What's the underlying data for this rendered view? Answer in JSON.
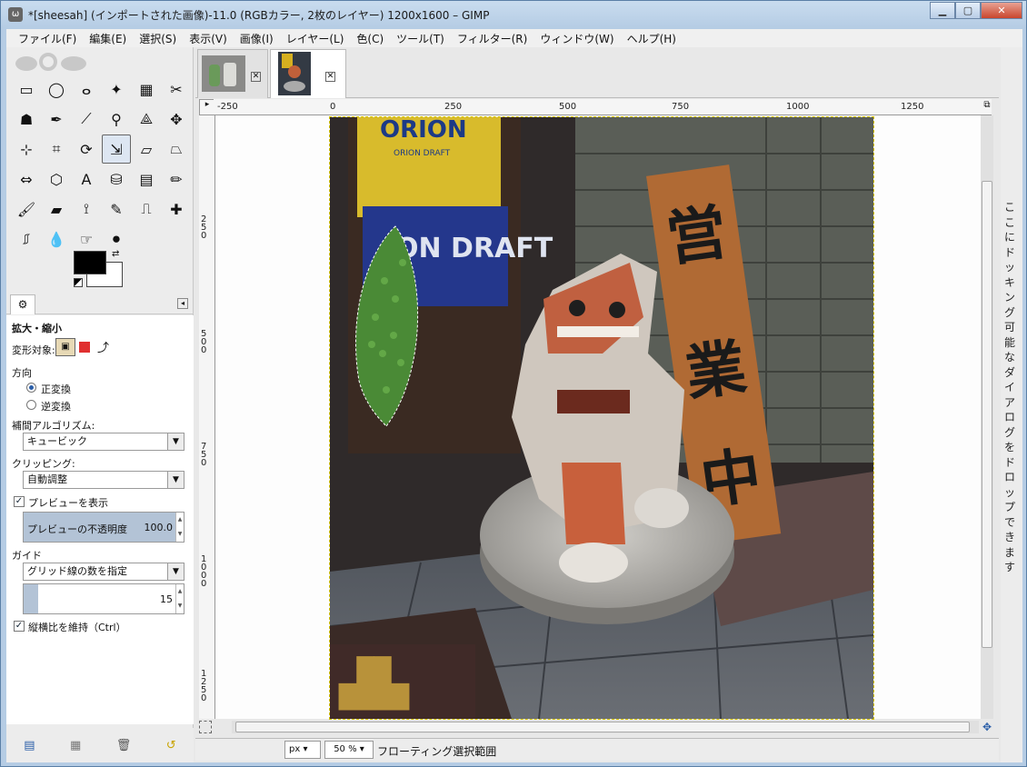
{
  "window": {
    "title": "*[sheesah] (インポートされた画像)-11.0 (RGBカラー, 2枚のレイヤー) 1200x1600 – GIMP",
    "icon": "gimp-icon",
    "controls": {
      "minimize": "▁",
      "maximize": "▢",
      "close": "✕"
    }
  },
  "menubar": [
    "ファイル(F)",
    "編集(E)",
    "選択(S)",
    "表示(V)",
    "画像(I)",
    "レイヤー(L)",
    "色(C)",
    "ツール(T)",
    "フィルター(R)",
    "ウィンドウ(W)",
    "ヘルプ(H)"
  ],
  "toolbox": {
    "tools": [
      {
        "name": "rect-select-icon",
        "glyph": "▭"
      },
      {
        "name": "ellipse-select-icon",
        "glyph": "◯"
      },
      {
        "name": "lasso-icon",
        "glyph": "ⴰ"
      },
      {
        "name": "fuzzy-select-icon",
        "glyph": "✦"
      },
      {
        "name": "color-select-icon",
        "glyph": "▦"
      },
      {
        "name": "scissors-icon",
        "glyph": "✂"
      },
      {
        "name": "foreground-select-icon",
        "glyph": "☗"
      },
      {
        "name": "paths-icon",
        "glyph": "✒"
      },
      {
        "name": "color-picker-icon",
        "glyph": "⟋"
      },
      {
        "name": "zoom-icon",
        "glyph": "⚲"
      },
      {
        "name": "measure-icon",
        "glyph": "⟁"
      },
      {
        "name": "move-icon",
        "glyph": "✥"
      },
      {
        "name": "align-icon",
        "glyph": "⊹"
      },
      {
        "name": "crop-icon",
        "glyph": "⌗"
      },
      {
        "name": "rotate-icon",
        "glyph": "⟳"
      },
      {
        "name": "scale-icon",
        "glyph": "⇲",
        "active": true
      },
      {
        "name": "shear-icon",
        "glyph": "▱"
      },
      {
        "name": "perspective-icon",
        "glyph": "⏢"
      },
      {
        "name": "flip-icon",
        "glyph": "⇔"
      },
      {
        "name": "cage-icon",
        "glyph": "⬡"
      },
      {
        "name": "text-icon",
        "glyph": "A"
      },
      {
        "name": "bucket-fill-icon",
        "glyph": "⛁"
      },
      {
        "name": "blend-icon",
        "glyph": "▤"
      },
      {
        "name": "pencil-icon",
        "glyph": "✏"
      },
      {
        "name": "paintbrush-icon",
        "glyph": "🖌"
      },
      {
        "name": "eraser-icon",
        "glyph": "▰"
      },
      {
        "name": "airbrush-icon",
        "glyph": "⟟"
      },
      {
        "name": "ink-icon",
        "glyph": "✎"
      },
      {
        "name": "clone-icon",
        "glyph": "⎍"
      },
      {
        "name": "heal-icon",
        "glyph": "✚"
      },
      {
        "name": "perspective-clone-icon",
        "glyph": "⎎"
      },
      {
        "name": "blur-icon",
        "glyph": "💧"
      },
      {
        "name": "smudge-icon",
        "glyph": "☞"
      },
      {
        "name": "dodge-burn-icon",
        "glyph": "⚫"
      }
    ],
    "fg_color": "#000000",
    "bg_color": "#ffffff"
  },
  "tool_options": {
    "title": "拡大・縮小",
    "transform_label": "変形対象:",
    "direction_label": "方向",
    "direction_options": [
      "正変換",
      "逆変換"
    ],
    "interpolation_label": "補間アルゴリズム:",
    "interpolation_value": "キュービック",
    "clipping_label": "クリッピング:",
    "clipping_value": "自動調整",
    "preview_label": "プレビューを表示",
    "opacity_label": "プレビューの不透明度",
    "opacity_value": "100.0",
    "guide_label": "ガイド",
    "guide_value": "グリッド線の数を指定",
    "grid_lines_value": "15",
    "aspect_label": "縦横比を維持（Ctrl）"
  },
  "ruler": {
    "h_ticks": [
      "-250",
      "0",
      "250",
      "500",
      "750",
      "1000",
      "1250"
    ],
    "v_ticks": [
      "250",
      "500",
      "750",
      "1000",
      "1250"
    ]
  },
  "photo_text": {
    "banner_top": "ORION",
    "banner_sub": "ORION DRAFT",
    "poster": "ON DRAFT",
    "sign": "営業中"
  },
  "statusbar": {
    "unit": "px",
    "zoom": "50 %",
    "message": "フローティング選択範囲"
  },
  "dock": {
    "text": "ここにドッキング可能なダイアログをドロップできます"
  }
}
